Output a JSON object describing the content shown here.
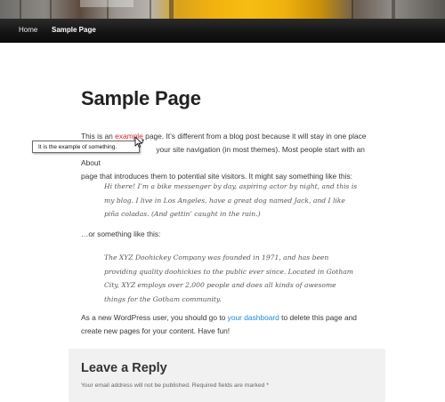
{
  "nav": {
    "items": [
      {
        "label": "Home"
      },
      {
        "label": "Sample Page"
      }
    ]
  },
  "page": {
    "title": "Sample Page",
    "intro": {
      "before": "This is an ",
      "hover_link": "example",
      "line1_rest": " page. It’s different from a blog post because it will stay in one place",
      "line2_rest": " your site navigation (in most themes). Most people start with an About",
      "line3": "page that introduces them to potential site visitors. It might say something like this:"
    },
    "quote1": {
      "line1": "Hi there! I’m a bike messenger by day, aspiring actor by night, and this is",
      "line2": "my blog. I live in Los Angeles, have a great dog named Jack, and I like",
      "line3": "piña coladas. (And gettin’ caught in the rain.)"
    },
    "or_text": "…or something like this:",
    "quote2": {
      "line1": "The XYZ Doohickey Company was founded in 1971, and has been",
      "line2": "providing quality doohickies to the public ever since. Located in Gotham",
      "line3": "City, XYZ employs over 2,000 people and does all kinds of awesome",
      "line4": "things for the Gotham community."
    },
    "closing": {
      "before": "As a new WordPress user, you should go to ",
      "link": "your dashboard",
      "after": " to delete this page and",
      "line2": "create new pages for your content. Have fun!"
    }
  },
  "tooltip": {
    "text": "It is the example of something."
  },
  "reply": {
    "title": "Leave a Reply",
    "note": "Your email address will not be published. Required fields are marked ",
    "required_mark": "*"
  },
  "colors": {
    "link": "#1b8be0",
    "hover_link": "#d0282a",
    "nav_bg": "#141414",
    "reply_bg": "#f1f1f1"
  }
}
